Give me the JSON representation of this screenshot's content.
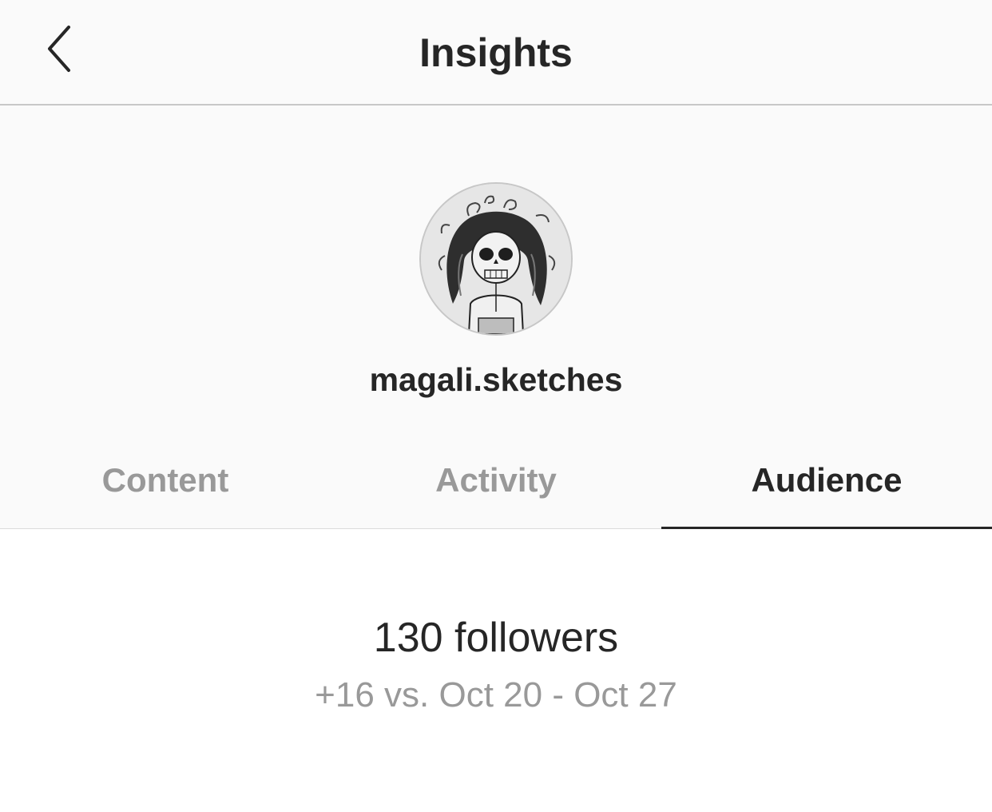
{
  "header": {
    "back_icon": "chevron-left-icon",
    "title": "Insights"
  },
  "profile": {
    "avatar": "sketch-skull-girl-avatar",
    "username": "magali.sketches"
  },
  "tabs": [
    {
      "label": "Content",
      "active": false
    },
    {
      "label": "Activity",
      "active": false
    },
    {
      "label": "Audience",
      "active": true
    }
  ],
  "audience": {
    "followers_label": "130 followers",
    "comparison": "+16 vs. Oct 20 - Oct 27"
  },
  "colors": {
    "background_top": "#fafafa",
    "text_primary": "#262626",
    "text_secondary": "#999999",
    "active_indicator": "#262626"
  }
}
